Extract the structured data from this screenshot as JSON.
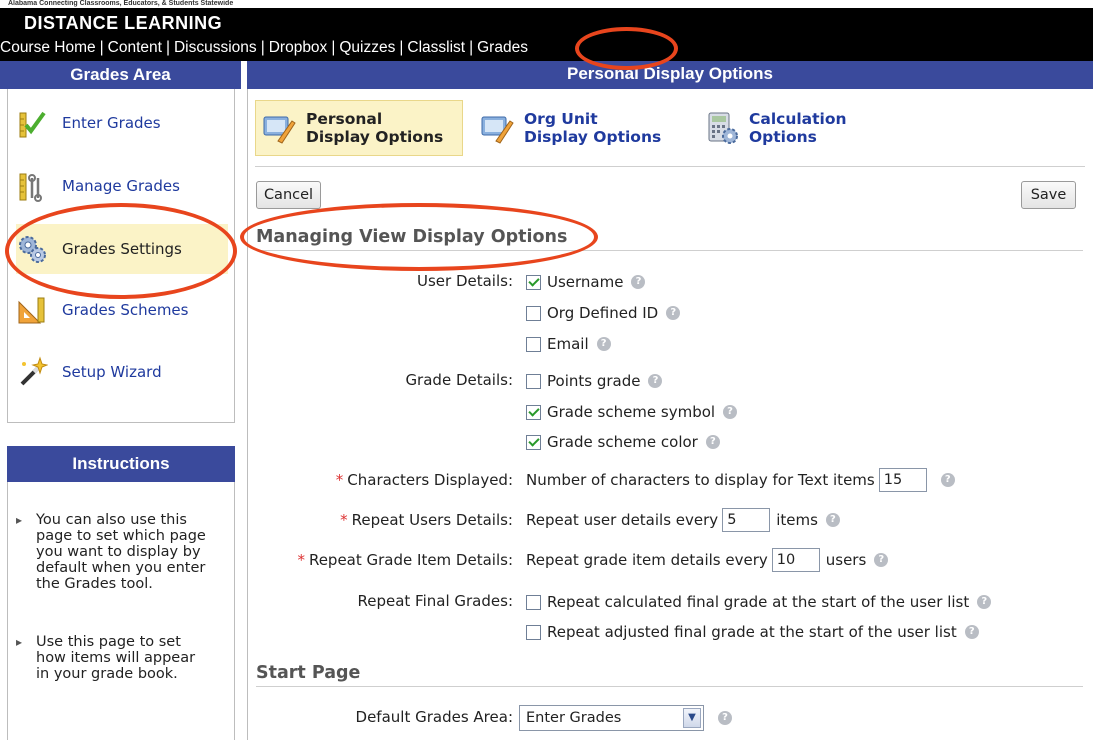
{
  "banner": {
    "tagline": "Alabama Connecting Classrooms, Educators, & Students Statewide",
    "title": "DISTANCE LEARNING"
  },
  "nav": {
    "links": [
      "Course Home",
      "Content",
      "Discussions",
      "Dropbox",
      "Quizzes",
      "Classlist",
      "Grades"
    ]
  },
  "sidebar": {
    "header": "Grades Area",
    "items": [
      {
        "label": "Enter Grades",
        "icon": "enter-grades-icon"
      },
      {
        "label": "Manage Grades",
        "icon": "manage-grades-icon"
      },
      {
        "label": "Grades Settings",
        "icon": "gears-icon",
        "active": true
      },
      {
        "label": "Grades Schemes",
        "icon": "ruler-icon"
      },
      {
        "label": "Setup Wizard",
        "icon": "wand-icon"
      }
    ]
  },
  "instructions": {
    "header": "Instructions",
    "items": [
      "You can also use this page to set which page you want to display by default when you enter the Grades tool.",
      "Use this page to set how items will appear in your grade book."
    ]
  },
  "main": {
    "header": "Personal Display Options",
    "tabs": [
      {
        "line1": "Personal",
        "line2": "Display Options",
        "active": true
      },
      {
        "line1": "Org Unit",
        "line2": "Display Options"
      },
      {
        "line1": "Calculation",
        "line2": "Options"
      }
    ],
    "cancel_label": "Cancel",
    "save_label": "Save",
    "section1_title": "Managing View Display Options",
    "user_details_label": "User Details:",
    "user_details": [
      {
        "label": "Username",
        "checked": true
      },
      {
        "label": "Org Defined ID",
        "checked": false
      },
      {
        "label": "Email",
        "checked": false
      }
    ],
    "grade_details_label": "Grade Details:",
    "grade_details": [
      {
        "label": "Points grade",
        "checked": false
      },
      {
        "label": "Grade scheme symbol",
        "checked": true
      },
      {
        "label": "Grade scheme color",
        "checked": true
      }
    ],
    "chars_label": "Characters Displayed:",
    "chars_text": "Number of characters to display for Text items",
    "chars_value": "15",
    "repeat_users_label": "Repeat Users Details:",
    "repeat_users_text": "Repeat user details every",
    "repeat_users_value": "5",
    "repeat_users_suffix": "items",
    "repeat_items_label": "Repeat Grade Item Details:",
    "repeat_items_text": "Repeat grade item details every",
    "repeat_items_value": "10",
    "repeat_items_suffix": "users",
    "repeat_final_label": "Repeat Final Grades:",
    "repeat_final": [
      {
        "label": "Repeat calculated final grade at the start of the user list",
        "checked": false
      },
      {
        "label": "Repeat adjusted final grade at the start of the user list",
        "checked": false
      }
    ],
    "required_mark": "*",
    "section2_title": "Start Page",
    "default_area_label": "Default Grades Area:",
    "default_area_value": "Enter Grades"
  },
  "colors": {
    "header_blue": "#3a4a9c",
    "highlight": "#fbf3c7",
    "annotation_red": "#e8451d",
    "link_blue": "#1f3a9e"
  }
}
